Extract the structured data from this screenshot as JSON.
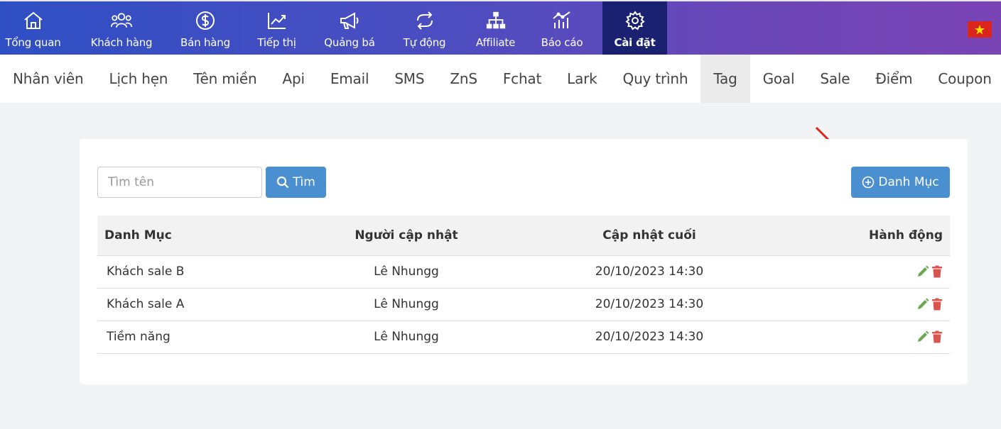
{
  "topnav": {
    "items": [
      {
        "label": "Tổng quan",
        "icon": "home-icon"
      },
      {
        "label": "Khách hàng",
        "icon": "users-icon"
      },
      {
        "label": "Bán hàng",
        "icon": "dollar-icon"
      },
      {
        "label": "Tiếp thị",
        "icon": "trend-chart-icon"
      },
      {
        "label": "Quảng bá",
        "icon": "megaphone-icon"
      },
      {
        "label": "Tự động",
        "icon": "repeat-icon"
      },
      {
        "label": "Affiliate",
        "icon": "sitemap-icon"
      },
      {
        "label": "Báo cáo",
        "icon": "report-chart-icon"
      },
      {
        "label": "Cài đặt",
        "icon": "gear-icon"
      }
    ],
    "active_index": 8,
    "flag_icon": "vietnam-flag-icon"
  },
  "subnav": {
    "items": [
      "Nhân viên",
      "Lịch hẹn",
      "Tên miền",
      "Api",
      "Email",
      "SMS",
      "ZnS",
      "Fchat",
      "Lark",
      "Quy trình",
      "Tag",
      "Goal",
      "Sale",
      "Điểm",
      "Coupon"
    ],
    "active_index": 10
  },
  "search": {
    "placeholder": "Tìm tên",
    "value": "",
    "button_label": "Tìm"
  },
  "add_button_label": "Danh Mục",
  "table": {
    "headers": [
      "Danh Mục",
      "Người cập nhật",
      "Cập nhật cuối",
      "Hành động"
    ],
    "rows": [
      {
        "name": "Khách sale B",
        "updated_by": "Lê Nhungg",
        "updated_at": "20/10/2023 14:30"
      },
      {
        "name": "Khách sale A",
        "updated_by": "Lê Nhungg",
        "updated_at": "20/10/2023 14:30"
      },
      {
        "name": "Tiềm năng",
        "updated_by": "Lê Nhungg",
        "updated_at": "20/10/2023 14:30"
      }
    ]
  },
  "colors": {
    "primary_button": "#4a8fd0",
    "edit_icon": "#6aa84f",
    "delete_icon": "#d9534f",
    "annotation_arrow": "#e02020"
  }
}
